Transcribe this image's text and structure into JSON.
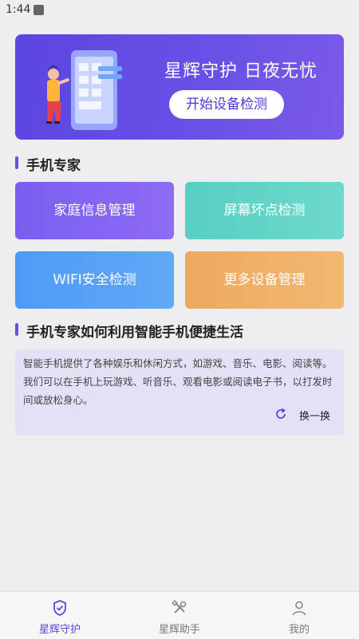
{
  "status_bar": {
    "time": "1:44"
  },
  "banner": {
    "title": "星辉守护 日夜无忧",
    "button_label": "开始设备检测"
  },
  "section_expert": {
    "title": "手机专家"
  },
  "cards": [
    {
      "label": "家庭信息管理"
    },
    {
      "label": "屏幕坏点检测"
    },
    {
      "label": "WIFI安全检测"
    },
    {
      "label": "更多设备管理"
    }
  ],
  "section_article": {
    "title": "手机专家如何利用智能手机便捷生活"
  },
  "article": {
    "text": "智能手机提供了各种娱乐和休闲方式，如游戏、音乐、电影、阅读等。我们可以在手机上玩游戏、听音乐、观看电影或阅读电子书，以打发时间或放松身心。",
    "refresh_label": "换一换"
  },
  "tabbar": {
    "items": [
      {
        "label": "星辉守护",
        "icon": "shield-check-icon",
        "active": true
      },
      {
        "label": "星辉助手",
        "icon": "tools-icon",
        "active": false
      },
      {
        "label": "我的",
        "icon": "user-icon",
        "active": false
      }
    ]
  },
  "colors": {
    "accent": "#5a46e0"
  }
}
